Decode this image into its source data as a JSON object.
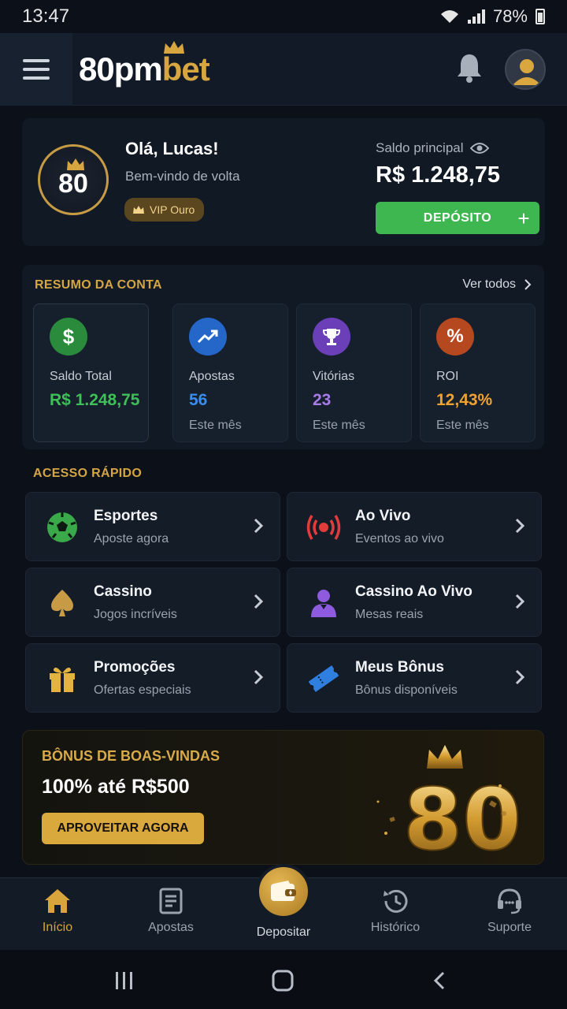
{
  "status_bar": {
    "time": "13:47",
    "battery": "78%"
  },
  "header": {
    "logo_part1": "80pm",
    "logo_part2": "bet"
  },
  "profile": {
    "badge_number": "80",
    "greeting": "Olá, Lucas!",
    "welcome": "Bem-vindo de volta",
    "vip_label": "VIP Ouro",
    "balance_label": "Saldo principal",
    "balance_value": "R$ 1.248,75",
    "deposit_label": "DEPÓSITO",
    "deposit_plus": "+"
  },
  "summary": {
    "title": "RESUMO DA CONTA",
    "see_all": "Ver todos",
    "cards": [
      {
        "icon": "dollar-icon",
        "label": "Saldo Total",
        "value": "R$ 1.248,75",
        "sub": "",
        "color": "#3fbf58"
      },
      {
        "icon": "trending-up-icon",
        "label": "Apostas",
        "value": "56",
        "sub": "Este mês",
        "color": "#3a8df0"
      },
      {
        "icon": "trophy-icon",
        "label": "Vitórias",
        "value": "23",
        "sub": "Este mês",
        "color": "#a67be8"
      },
      {
        "icon": "percent-icon",
        "label": "ROI",
        "value": "12,43%",
        "sub": "Este mês",
        "color": "#f0a132"
      }
    ]
  },
  "quick_access": {
    "title": "ACESSO RÁPIDO",
    "items": [
      {
        "icon": "soccer-ball-icon",
        "title": "Esportes",
        "subtitle": "Aposte agora"
      },
      {
        "icon": "live-broadcast-icon",
        "title": "Ao Vivo",
        "subtitle": "Eventos ao vivo"
      },
      {
        "icon": "spade-icon",
        "title": "Cassino",
        "subtitle": "Jogos incríveis"
      },
      {
        "icon": "dealer-icon",
        "title": "Cassino Ao Vivo",
        "subtitle": "Mesas reais"
      },
      {
        "icon": "gift-icon",
        "title": "Promoções",
        "subtitle": "Ofertas especiais"
      },
      {
        "icon": "ticket-icon",
        "title": "Meus Bônus",
        "subtitle": "Bônus disponíveis"
      }
    ]
  },
  "banner": {
    "title": "BÔNUS DE BOAS-VINDAS",
    "headline": "100% até R$500",
    "button": "APROVEITAR AGORA",
    "art_text": "80"
  },
  "bottom_nav": {
    "items": [
      {
        "icon": "home-icon",
        "label": "Início",
        "active": true
      },
      {
        "icon": "bets-icon",
        "label": "Apostas",
        "active": false
      },
      {
        "icon": "wallet-icon",
        "label": "Depositar",
        "active": false
      },
      {
        "icon": "history-icon",
        "label": "Histórico",
        "active": false
      },
      {
        "icon": "support-headset-icon",
        "label": "Suporte",
        "active": false
      }
    ]
  },
  "colors": {
    "accent_gold": "#d7a640",
    "deposit_green": "#3fb750",
    "background": "#0c1119"
  }
}
